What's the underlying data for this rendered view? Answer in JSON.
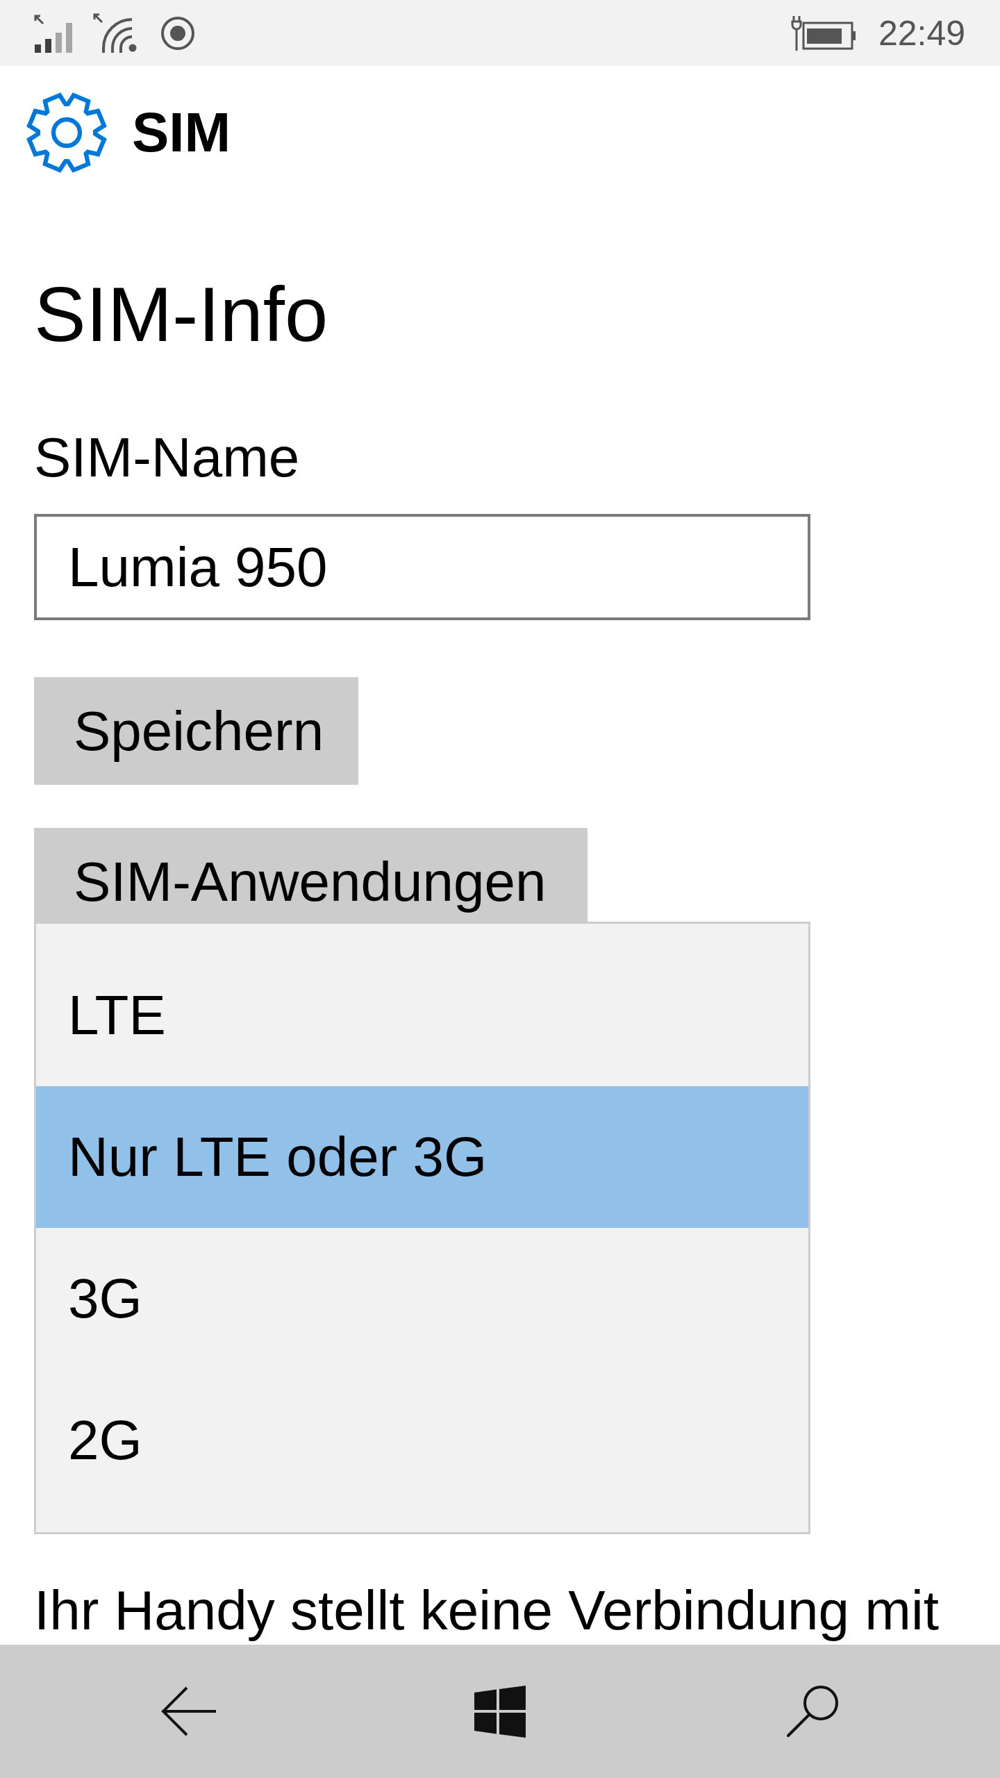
{
  "status_bar": {
    "time": "22:49"
  },
  "header": {
    "title": "SIM"
  },
  "page": {
    "heading": "SIM-Info",
    "sim_name": {
      "label": "SIM-Name",
      "value": "Lumia 950"
    },
    "save_button": {
      "label": "Speichern"
    },
    "sim_apps_button": {
      "label": "SIM-Anwendungen"
    },
    "dropdown": {
      "options": [
        {
          "label": "LTE",
          "selected": false
        },
        {
          "label": "Nur LTE oder 3G",
          "selected": true
        },
        {
          "label": "3G",
          "selected": false
        },
        {
          "label": "2G",
          "selected": false
        }
      ]
    },
    "footer_text": "Ihr Handy stellt keine Verbindung mit"
  }
}
